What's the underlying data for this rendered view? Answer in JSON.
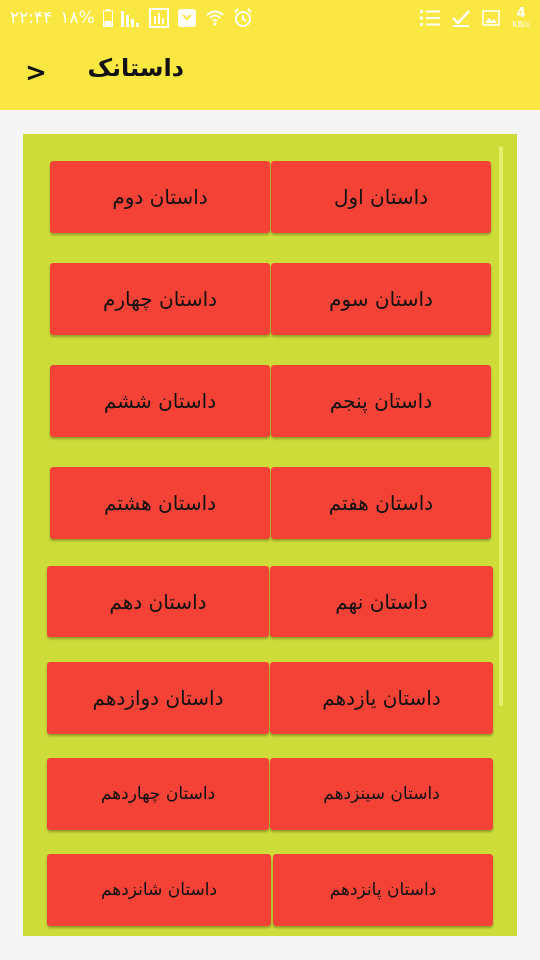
{
  "status_bar": {
    "time": "۲۲:۴۴",
    "battery": "۱۸%",
    "net_speed_value": "4",
    "net_speed_unit": "KB/s"
  },
  "app_bar": {
    "title": "داستانک",
    "back_glyph": ">"
  },
  "stories": [
    "داستان اول",
    "داستان دوم",
    "داستان سوم",
    "داستان چهارم",
    "داستان پنجم",
    "داستان ششم",
    "داستان هفتم",
    "داستان هشتم",
    "داستان نهم",
    "داستان دهم",
    "داستان یازدهم",
    "داستان دوازدهم",
    "داستان سینزدهم",
    "داستان چهاردهم",
    "داستان پانزدهم",
    "داستان شانزدهم"
  ],
  "colors": {
    "app_bar": "#fbe742",
    "panel": "#cddc39",
    "button": "#f44336"
  }
}
